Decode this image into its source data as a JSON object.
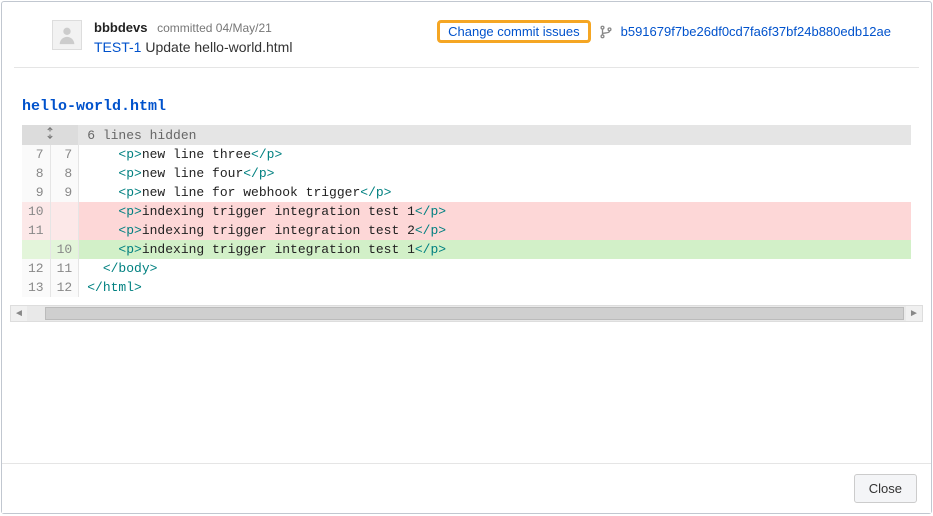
{
  "commit": {
    "author": "bbbdevs",
    "committed_label": "committed 04/May/21",
    "issue_key": "TEST-1",
    "message_rest": " Update hello-world.html",
    "change_link": "Change commit issues",
    "hash": "b591679f7be26df0cd7fa6f37bf24b880edb12ae"
  },
  "file": {
    "name": "hello-world.html"
  },
  "diff": {
    "hidden_label": "6 lines hidden",
    "rows": [
      {
        "type": "ctx",
        "old": "7",
        "new": "7",
        "indent": "m",
        "html": "<span class='tag'>&lt;p&gt;</span><span class='txt'>new line three</span><span class='tag'>&lt;/p&gt;</span>"
      },
      {
        "type": "ctx",
        "old": "8",
        "new": "8",
        "indent": "m",
        "html": "<span class='tag'>&lt;p&gt;</span><span class='txt'>new line four</span><span class='tag'>&lt;/p&gt;</span>"
      },
      {
        "type": "ctx",
        "old": "9",
        "new": "9",
        "indent": "m",
        "html": "<span class='tag'>&lt;p&gt;</span><span class='txt'>new line for webhook trigger</span><span class='tag'>&lt;/p&gt;</span>"
      },
      {
        "type": "del",
        "old": "10",
        "new": "",
        "indent": "m",
        "html": "<span class='tag'>&lt;p&gt;</span><span class='txt'>indexing trigger integration test 1</span><span class='tag'>&lt;/p&gt;</span>"
      },
      {
        "type": "del",
        "old": "11",
        "new": "",
        "indent": "m",
        "html": "<span class='tag'>&lt;p&gt;</span><span class='txt'>indexing trigger integration test 2</span><span class='tag'>&lt;/p&gt;</span>"
      },
      {
        "type": "add",
        "old": "",
        "new": "10",
        "indent": "m",
        "html": "<span class='tag'>&lt;p&gt;</span><span class='txt'>indexing trigger integration test 1</span><span class='tag'>&lt;/p&gt;</span>"
      },
      {
        "type": "ctx",
        "old": "12",
        "new": "11",
        "indent": "s",
        "html": "<span class='tag'>&lt;/body&gt;</span>"
      },
      {
        "type": "ctx",
        "old": "13",
        "new": "12",
        "indent": "",
        "html": "<span class='tag'>&lt;/html&gt;</span>"
      }
    ]
  },
  "footer": {
    "close": "Close"
  }
}
